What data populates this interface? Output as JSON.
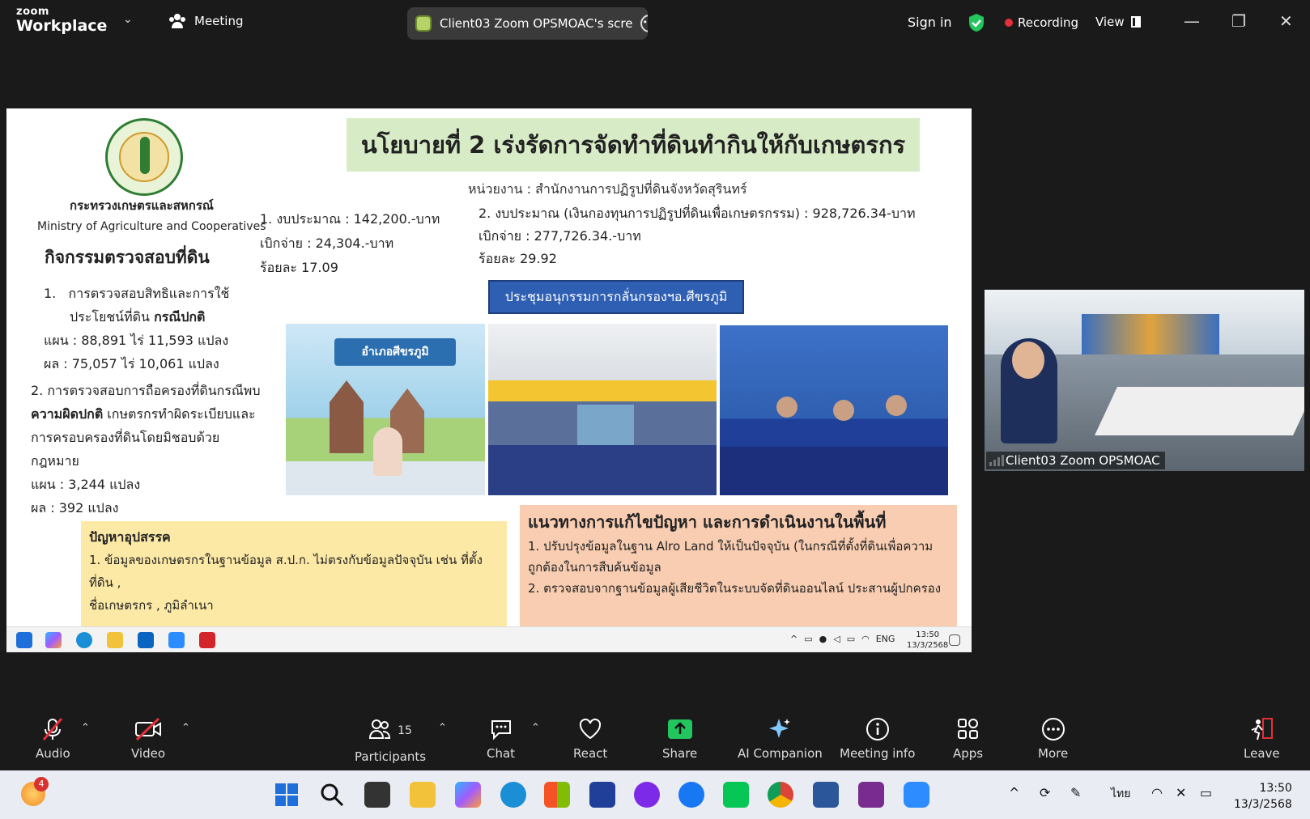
{
  "app": {
    "brand_small": "zoom",
    "brand_big": "Workplace",
    "meeting_tab": "Meeting",
    "share_title": "Client03 Zoom OPSMOAC's scre",
    "sign_in": "Sign in",
    "recording": "Recording",
    "view": "View"
  },
  "slide": {
    "ministry_th": "กระทรวงเกษตรและสหกรณ์",
    "ministry_en": "Ministry of Agriculture and Cooperatives",
    "policy_title": "นโยบายที่ 2 เร่งรัดการจัดทำที่ดินทำกินให้กับเกษตรกร",
    "agency": "หน่วยงาน : สำนักงานการปฏิรูปที่ดินจังหวัดสุรินทร์",
    "budget1": [
      "1. งบประมาณ : 142,200.-บาท",
      "เบิกจ่าย : 24,304.-บาท",
      "ร้อยละ 17.09"
    ],
    "budget2": [
      "2. งบประมาณ (เงินกองทุนการปฏิรูปที่ดินเพื่อเกษตรกรรม) : 928,726.34-บาท",
      "เบิกจ่าย : 277,726.34.-บาท",
      "ร้อยละ 29.92"
    ],
    "activity_title": "กิจกรรมตรวจสอบที่ดิน",
    "item1_num": "1.",
    "item1_a": "การตรวจสอบสิทธิและการใช้",
    "item1_b": "ประโยชน์ที่ดิน ",
    "item1_b_bold": "กรณีปกติ",
    "item1_plan": "แผน : 88,891 ไร่ 11,593 แปลง",
    "item1_result": "ผล : 75,057 ไร่ 10,061 แปลง",
    "item2_a": "2. การตรวจสอบการถือครองที่ดินกรณีพบ",
    "item2_b_bold": "ความผิดปกติ",
    "item2_b": " เกษตรกรทำผิดระเบียบและ",
    "item2_c": "การครอบครองที่ดินโดยมิชอบด้วย",
    "item2_d": "กฎหมาย",
    "item2_plan": "แผน : 3,244 แปลง",
    "item2_result": "ผล : 392 แปลง",
    "meeting_label": "ประชุมอนุกรรมการกลั่นกรองฯอ.ศีขรภูมิ",
    "photo1_banner": "อำเภอศีขรภูมิ",
    "problem_title": "ปัญหาอุปสรรค",
    "problem_1": "1. ข้อมูลของเกษตรกรในฐานข้อมูล ส.ป.ก. ไม่ตรงกับข้อมูลปัจจุบัน เช่น ที่ตั้งที่ดิน ,",
    "problem_1b": "ชื่อเกษตรกร , ภูมิลำเนา",
    "solution_title": "แนวทางการแก้ไขปัญหา และการดำเนินงานในพื้นที่",
    "solution_1": "1. ปรับปรุงข้อมูลในฐาน Alro Land ให้เป็นปัจจุบัน (ในกรณีที่ตั้งที่ดินเพื่อความ",
    "solution_1b": "ถูกต้องในการสืบค้นข้อมูล",
    "solution_2": "2. ตรวจสอบจากฐานข้อมูลผู้เสียชีวิตในระบบจัดที่ดินออนไลน์ ประสานผู้ปกครอง"
  },
  "remote_taskbar": {
    "lang": "ENG",
    "time": "13:50",
    "date": "13/3/2568"
  },
  "video": {
    "name": "Client03 Zoom OPSMOAC"
  },
  "controls": {
    "audio": "Audio",
    "video": "Video",
    "participants": "Participants",
    "participants_count": "15",
    "chat": "Chat",
    "react": "React",
    "share": "Share",
    "ai": "AI Companion",
    "info": "Meeting info",
    "apps": "Apps",
    "more": "More",
    "leave": "Leave"
  },
  "taskbar": {
    "badge": "4",
    "lang": "ไทย",
    "time": "13:50",
    "date": "13/3/2568"
  },
  "colors": {
    "share_green": "#22c55e",
    "leave_red": "#e5303b",
    "slide_title_bg": "#d7ebc6"
  }
}
